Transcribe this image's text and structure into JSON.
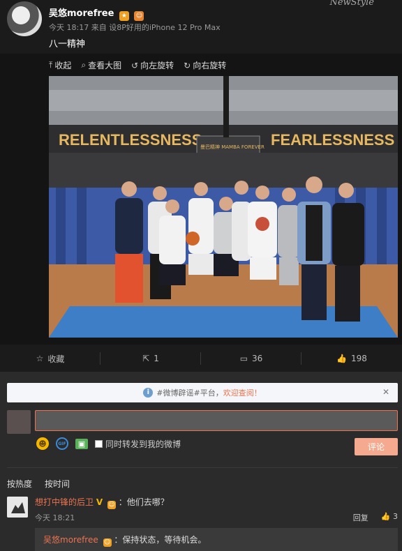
{
  "post": {
    "username": "吴悠morefree",
    "brand": "NewStyle",
    "meta": "今天 18:17 来自 设8P好用的iPhone 12 Pro Max",
    "text": "八一精神"
  },
  "media_tools": [
    {
      "icon": "arrow-up-icon",
      "glyph": "⤒",
      "label": "收起"
    },
    {
      "icon": "search-icon",
      "glyph": "⌕",
      "label": "查看大图"
    },
    {
      "icon": "rotate-left-icon",
      "glyph": "↺",
      "label": "向左旋转"
    },
    {
      "icon": "rotate-right-icon",
      "glyph": "↻",
      "label": "向右旋转"
    }
  ],
  "photo": {
    "banner_left": "RELENTLESSNESS",
    "banner_right": "FEARLESSNESS",
    "backboard": "曼巴精神 MAMBA FOREVER"
  },
  "actions": {
    "favorite": "收藏",
    "repost_count": "1",
    "comment_count": "36",
    "like_count": "198"
  },
  "notice": {
    "text": "#微博辟谣#平台，",
    "highlight": "欢迎查阅！"
  },
  "composer": {
    "input_value": "",
    "emoji_glyph": "☻",
    "gif_label": "GIF",
    "picture_glyph": "▣",
    "also_repost_label": "同时转发到我的微博",
    "submit_label": "评论"
  },
  "sort_tabs": [
    "按热度",
    "按时间"
  ],
  "comment": {
    "user": "想打中锋的后卫",
    "vip_mark": "V",
    "text": "：他们去哪？",
    "time": "今天 18:21",
    "reply_label": "回复",
    "like_count": "3"
  },
  "reply": {
    "user": "吴悠morefree",
    "text": "：保持状态，等待机会。"
  },
  "colors": {
    "accent": "#eb7350",
    "background": "#2b2b2b",
    "panel": "#1b1b1b"
  }
}
